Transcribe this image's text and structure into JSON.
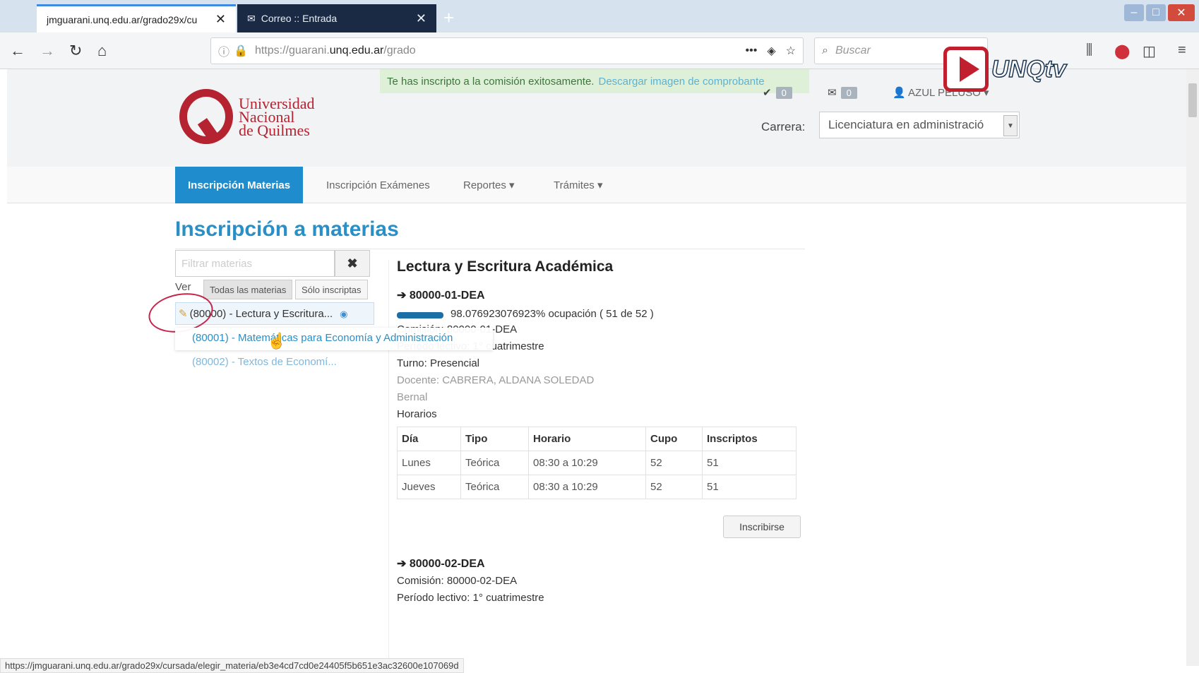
{
  "browser": {
    "tabs": [
      {
        "title": "jmguarani.unq.edu.ar/grado29x/cu",
        "close": "✕"
      },
      {
        "title": "Correo :: Entrada",
        "close": "✕"
      }
    ],
    "new_tab": "+",
    "url_prefix": "https://guarani.",
    "url_domain": "unq.edu.ar",
    "url_path": "/grado",
    "search_placeholder": "Buscar",
    "status_url": "https://jmguarani.unq.edu.ar/grado29x/cursada/elegir_materia/eb3e4cd7cd0e24405f5b651e3ac32600e107069d"
  },
  "watermark": "UNQtv",
  "header": {
    "logo_lines": [
      "Universidad",
      "Nacional",
      "de Quilmes"
    ],
    "alert_text": "Te has inscripto a la comisión exitosamente.",
    "alert_link": "Descargar imagen de comprobante",
    "notif_count": "0",
    "mail_count": "0",
    "user": "AZUL PELUSO",
    "carrera_label": "Carrera:",
    "carrera_value": "Licenciatura en administració"
  },
  "menu": [
    {
      "label": "Inscripción Materias",
      "active": true
    },
    {
      "label": "Inscripción Exámenes"
    },
    {
      "label": "Reportes ▾"
    },
    {
      "label": "Trámites ▾"
    }
  ],
  "main": {
    "title": "Inscripción a materias",
    "filter_placeholder": "Filtrar materias",
    "clear": "✖",
    "ver_label": "Ver",
    "ver_options": [
      "Todas las materias",
      "Sólo inscriptas"
    ],
    "materias": [
      "(80000) - Lectura y Escritura...",
      "(80001) - Matemáticas para Economía y Administración",
      "(80002) - Textos de Economí..."
    ]
  },
  "detail": {
    "title": "Lectura y Escritura Académica",
    "com1": {
      "code": "➔ 80000-01-DEA",
      "occupancy_text": "98.076923076923% ocupación ( 51 de 52 )",
      "occupancy_fraction": 0.98,
      "comision": "Comisión: 80000-01-DEA",
      "periodo": "Período lectivo: 1° cuatrimestre",
      "turno": "Turno: Presencial",
      "docente": "Docente: CABRERA, ALDANA SOLEDAD",
      "sede": "Bernal",
      "horarios": "Horarios",
      "table_headers": [
        "Día",
        "Tipo",
        "Horario",
        "Cupo",
        "Inscriptos"
      ],
      "rows": [
        [
          "Lunes",
          "Teórica",
          "08:30 a 10:29",
          "52",
          "51"
        ],
        [
          "Jueves",
          "Teórica",
          "08:30 a 10:29",
          "52",
          "51"
        ]
      ],
      "button": "Inscribirse"
    },
    "com2": {
      "code": "➔ 80000-02-DEA",
      "comision": "Comisión: 80000-02-DEA",
      "periodo": "Período lectivo: 1° cuatrimestre"
    }
  }
}
